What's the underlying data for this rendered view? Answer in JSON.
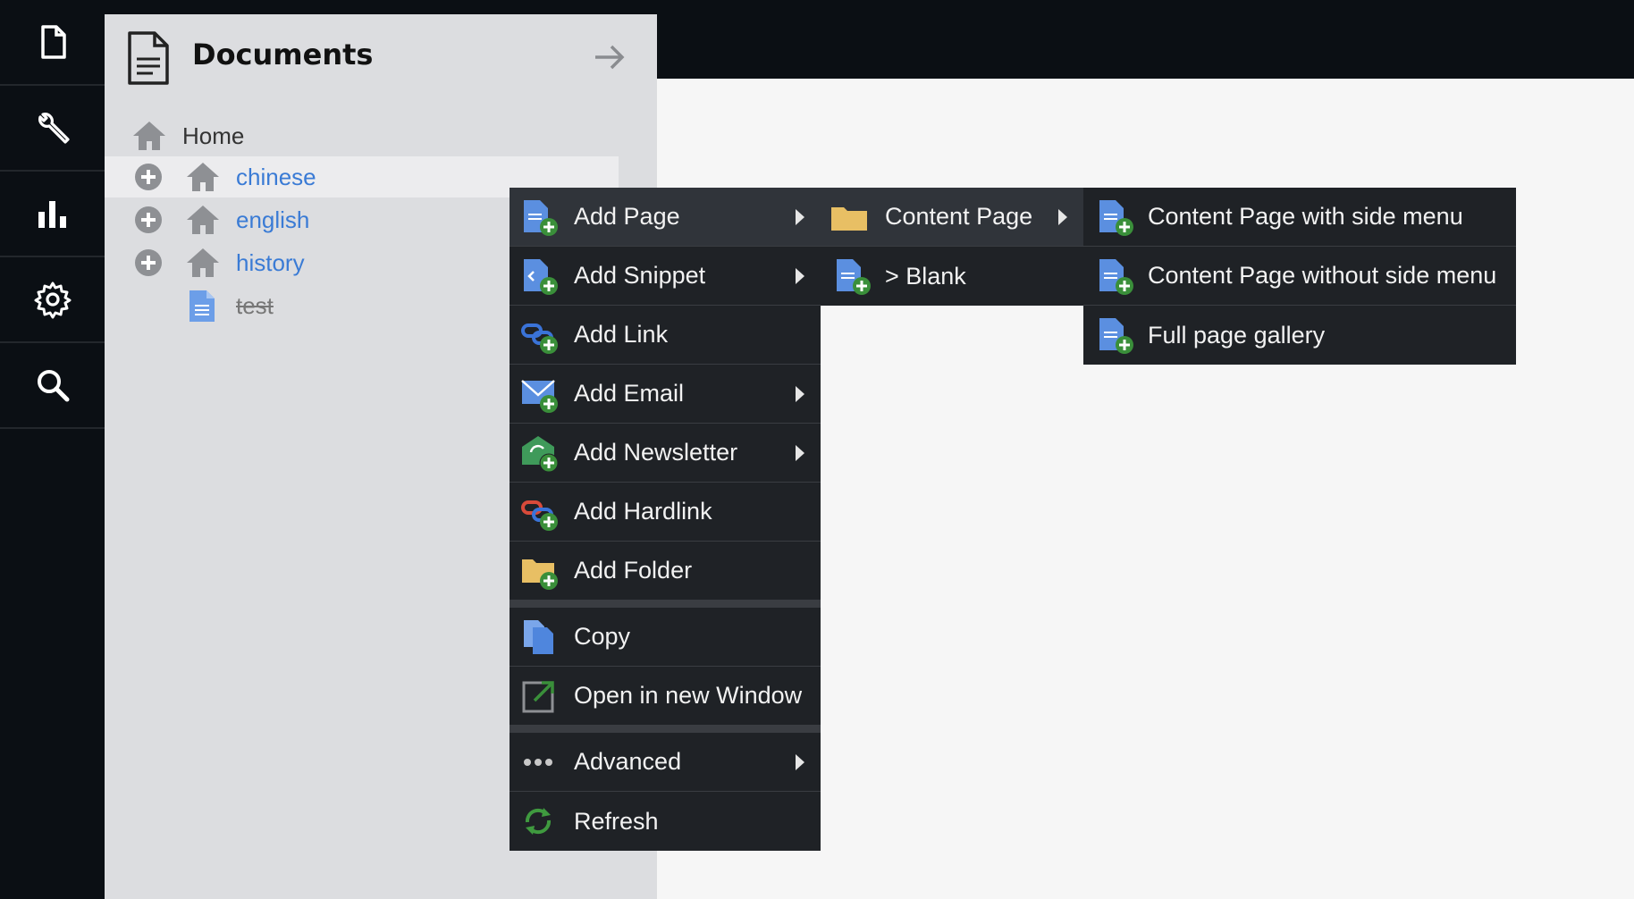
{
  "rail": {
    "items": [
      {
        "icon": "document-icon"
      },
      {
        "icon": "wrench-icon"
      },
      {
        "icon": "bar-chart-icon"
      },
      {
        "icon": "gear-icon"
      },
      {
        "icon": "search-icon"
      }
    ]
  },
  "panel": {
    "title": "Documents",
    "tree": [
      {
        "label": "Home",
        "color": "#333333",
        "expandable": false,
        "icon": "house-icon"
      },
      {
        "label": "chinese",
        "color": "#3a7bd5",
        "expandable": true,
        "icon": "house-icon",
        "selected": true
      },
      {
        "label": "english",
        "color": "#3a7bd5",
        "expandable": true,
        "icon": "house-icon"
      },
      {
        "label": "history",
        "color": "#3a7bd5",
        "expandable": true,
        "icon": "house-icon"
      },
      {
        "label": "test",
        "color": "#777777",
        "expandable": false,
        "icon": "page-icon",
        "strikethrough": true
      }
    ]
  },
  "context_menu": {
    "items": [
      {
        "label": "Add Page",
        "icon": "add-page-icon",
        "submenu": true,
        "active": true
      },
      {
        "label": "Add Snippet",
        "icon": "add-snippet-icon",
        "submenu": true
      },
      {
        "label": "Add Link",
        "icon": "add-link-icon",
        "submenu": false
      },
      {
        "label": "Add Email",
        "icon": "add-email-icon",
        "submenu": true
      },
      {
        "label": "Add Newsletter",
        "icon": "add-newsletter-icon",
        "submenu": true
      },
      {
        "label": "Add Hardlink",
        "icon": "add-hardlink-icon",
        "submenu": false
      },
      {
        "label": "Add Folder",
        "icon": "add-folder-icon",
        "submenu": false
      },
      {
        "label": "Copy",
        "icon": "copy-icon",
        "submenu": false
      },
      {
        "label": "Open in new Window",
        "icon": "open-new-window-icon",
        "submenu": false
      },
      {
        "label": "Advanced",
        "icon": "more-dots-icon",
        "submenu": true
      },
      {
        "label": "Refresh",
        "icon": "refresh-icon",
        "submenu": false
      }
    ]
  },
  "submenu_page": {
    "items": [
      {
        "label": "Content Page",
        "icon": "folder-icon",
        "submenu": true,
        "active": true
      },
      {
        "label": "> Blank",
        "icon": "add-page-icon",
        "submenu": false
      }
    ]
  },
  "submenu_content": {
    "items": [
      {
        "label": "Content Page with side menu",
        "icon": "add-page-icon"
      },
      {
        "label": "Content Page without side menu",
        "icon": "add-page-icon"
      },
      {
        "label": "Full page gallery",
        "icon": "add-page-icon"
      }
    ]
  },
  "colors": {
    "rail_bg": "#0b0f14",
    "panel_bg": "#dcdde0",
    "menu_bg": "#1f2226",
    "link_blue": "#3a7bd5",
    "add_green": "#3a8f3a"
  }
}
